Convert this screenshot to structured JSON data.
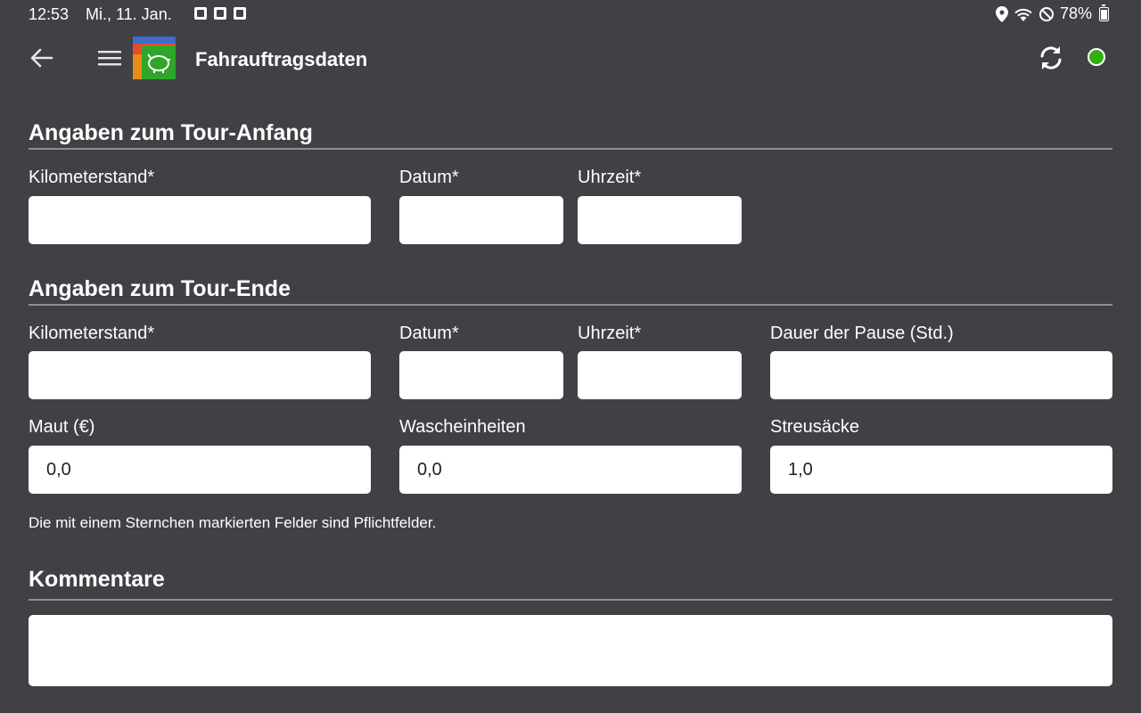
{
  "status_bar": {
    "time": "12:53",
    "date": "Mi., 11. Jan.",
    "battery": "78%",
    "notification_icons": [
      "image-icon",
      "contact-card-icon",
      "sim-card-icon"
    ],
    "system_icons": [
      "location-icon",
      "wifi-icon",
      "do-not-disturb-icon",
      "battery-icon"
    ]
  },
  "app_bar": {
    "title": "Fahrauftragsdaten",
    "status_color": "#2fae0f"
  },
  "tour_start": {
    "title": "Angaben zum Tour-Anfang",
    "km_label": "Kilometerstand*",
    "km_value": "",
    "date_label": "Datum*",
    "date_value": "",
    "time_label": "Uhrzeit*",
    "time_value": ""
  },
  "tour_end": {
    "title": "Angaben zum Tour-Ende",
    "km_label": "Kilometerstand*",
    "km_value": "",
    "date_label": "Datum*",
    "date_value": "",
    "time_label": "Uhrzeit*",
    "time_value": "",
    "pause_label": "Dauer der Pause (Std.)",
    "pause_value": "",
    "toll_label": "Maut (€)",
    "toll_value": "0,0",
    "wash_label": "Wascheinheiten",
    "wash_value": "0,0",
    "grit_label": "Streusäcke",
    "grit_value": "1,0"
  },
  "hint": "Die mit einem Sternchen markierten Felder sind Pflichtfelder.",
  "comments": {
    "title": "Kommentare",
    "value": ""
  }
}
